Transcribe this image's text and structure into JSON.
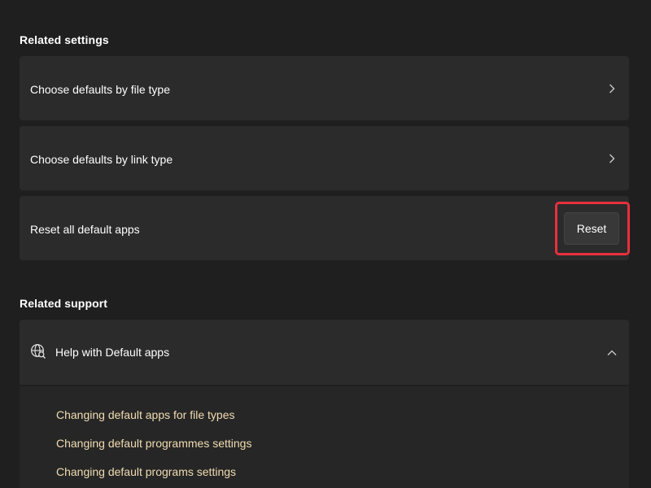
{
  "related_settings": {
    "title": "Related settings",
    "items": [
      {
        "label": "Choose defaults by file type"
      },
      {
        "label": "Choose defaults by link type"
      }
    ],
    "reset": {
      "label": "Reset all default apps",
      "button_label": "Reset"
    }
  },
  "related_support": {
    "title": "Related support",
    "help": {
      "label": "Help with Default apps",
      "expanded": true,
      "links": [
        "Changing default apps for file types",
        "Changing default programmes settings",
        "Changing default programs settings"
      ]
    }
  },
  "colors": {
    "background": "#1f1f1f",
    "card": "#2b2b2b",
    "link": "#f1dcb2",
    "highlight": "#e8303c"
  },
  "icons": {
    "chevron_right": "chevron-right-icon",
    "chevron_up": "chevron-up-icon",
    "globe_search": "globe-search-icon"
  }
}
